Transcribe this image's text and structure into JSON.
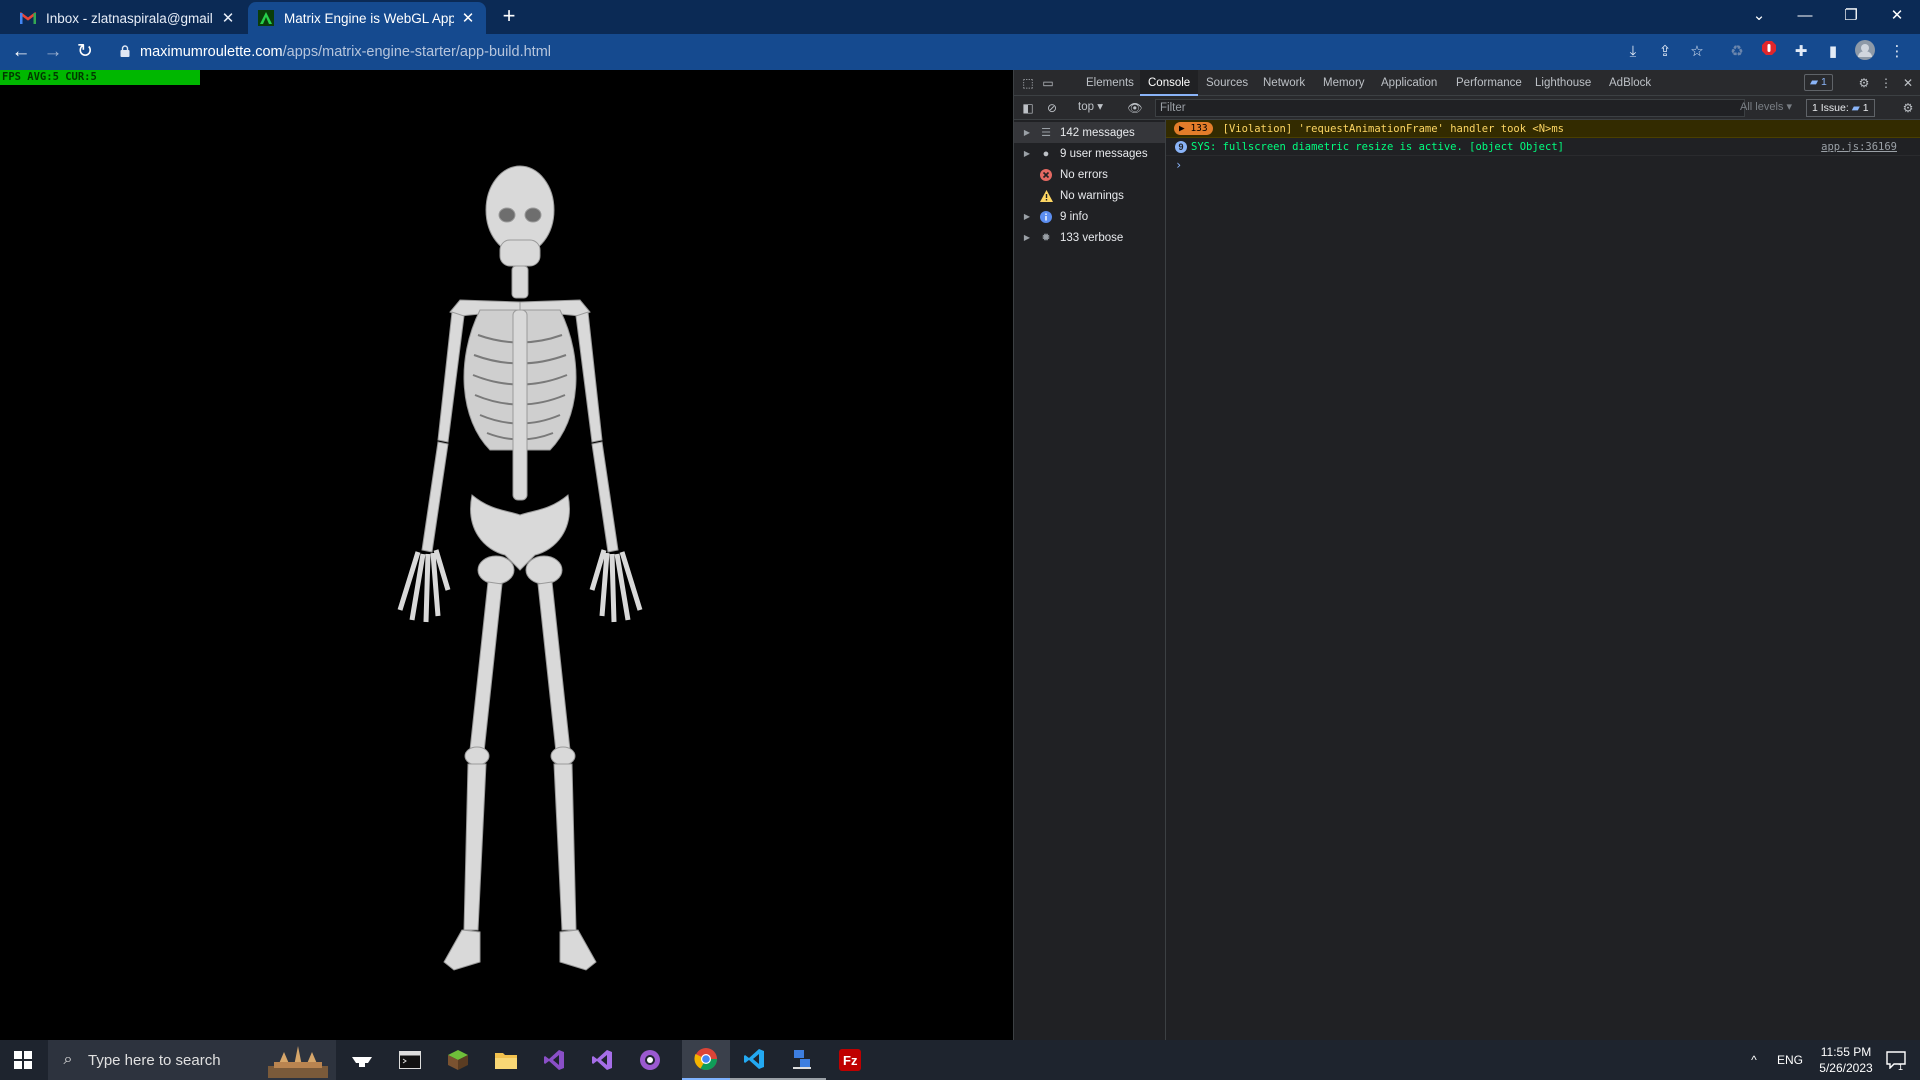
{
  "browser": {
    "tabs": [
      {
        "title": "Inbox - zlatnaspirala@gmail.com",
        "icon": "gmail-icon",
        "active": false
      },
      {
        "title": "Matrix Engine is WebGL App/Game",
        "icon": "matrix-engine-icon",
        "active": true
      }
    ],
    "new_tab_label": "+",
    "address": {
      "domain": "maximumroulette.com",
      "path": "/apps/matrix-engine-starter/app-build.html"
    }
  },
  "page": {
    "fps_text": "FPS AVG:5 CUR:5",
    "scene_object": "skeleton-model"
  },
  "devtools": {
    "tabs": [
      "Elements",
      "Console",
      "Sources",
      "Network",
      "Memory",
      "Application",
      "Performance",
      "Lighthouse",
      "AdBlock"
    ],
    "active_tab": "Console",
    "issues_badge_count": "1",
    "context": "top",
    "filter_placeholder": "Filter",
    "levels_label": "All levels",
    "issues_label": "1 Issue:",
    "issues_count": "1",
    "sidebar": [
      {
        "label": "142 messages",
        "icon": "list-icon",
        "expandable": true,
        "selected": true
      },
      {
        "label": "9 user messages",
        "icon": "user-icon",
        "expandable": true,
        "selected": false
      },
      {
        "label": "No errors",
        "icon": "error-icon",
        "expandable": false,
        "selected": false
      },
      {
        "label": "No warnings",
        "icon": "warning-icon",
        "expandable": false,
        "selected": false
      },
      {
        "label": "9 info",
        "icon": "info-icon",
        "expandable": true,
        "selected": false
      },
      {
        "label": "133 verbose",
        "icon": "verbose-icon",
        "expandable": true,
        "selected": false
      }
    ],
    "messages": [
      {
        "count": "133",
        "text": "[Violation] 'requestAnimationFrame' handler took <N>ms",
        "level": "violation",
        "source": ""
      },
      {
        "count": "9",
        "text": "SYS: fullscreen diametric resize is active. [object Object]",
        "level": "info",
        "source": "app.js:36169"
      }
    ],
    "prompt_symbol": "›",
    "colors": {
      "violation_bg": "#332b00",
      "violation_text": "#fdd663",
      "sys_text": "#00ff7f",
      "count_badge": "#e37d2a"
    }
  },
  "taskbar": {
    "search_placeholder": "Type here to search",
    "apps": [
      "matrix-engine-app-icon",
      "terminal-icon",
      "minecraft-icon",
      "file-explorer-icon",
      "visual-studio-icon",
      "visual-studio-alt-icon",
      "github-desktop-icon",
      "chrome-icon",
      "vscode-icon",
      "network-tool-icon",
      "filezilla-icon"
    ],
    "active_app": "chrome-icon",
    "language": "ENG",
    "time": "11:55 PM",
    "date": "5/26/2023",
    "notification_count": "1"
  },
  "colors": {
    "tabstrip": "#0b2a55",
    "toolbar": "#154a8f",
    "fps_bar": "#00b700",
    "devtools_bg": "#202124",
    "taskbar": "#1e242e"
  }
}
